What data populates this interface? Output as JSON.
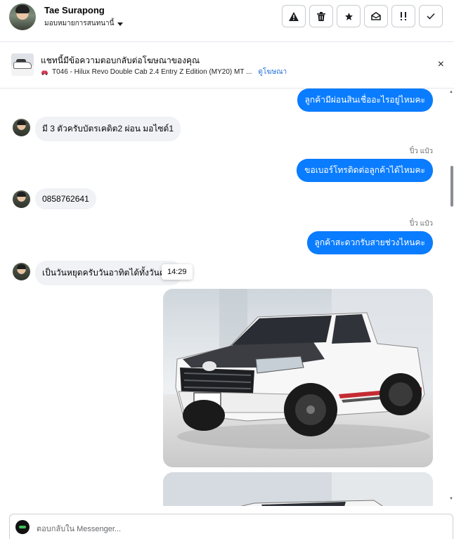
{
  "header": {
    "name": "Tae Surapong",
    "assign_label": "มอบหมายการสนทนานี้",
    "actions": [
      {
        "icon": "warning-icon",
        "glyph": "⚠"
      },
      {
        "icon": "trash-icon",
        "glyph": "🗑"
      },
      {
        "icon": "star-icon",
        "glyph": "★"
      },
      {
        "icon": "mark-unread-icon",
        "glyph": "✉"
      },
      {
        "icon": "follow-up-icon",
        "glyph": "!!"
      },
      {
        "icon": "check-icon",
        "glyph": "✓"
      }
    ]
  },
  "ad": {
    "title": "แชทนี้มีข้อความตอบกลับต่อโฆษณาของคุณ",
    "subtitle": "T046 - Hilux Revo Double Cab 2.4 Entry Z Edition (MY20) MT ...",
    "link": "ดูโฆษณา",
    "close": "×"
  },
  "messages": {
    "out1": "ลูกค้ามีผ่อนสินเชื่ออะไรอยู่ไหมคะ",
    "in1": "มี 3 ตัวครับบัตรเคดิต2 ผ่อน มอไซด์1",
    "sender2": "ปิ๋ว แป๋ว",
    "out2": "ขอเบอร์โทรติดต่อลูกค้าได้ไหมคะ",
    "in2": "0858762641",
    "sender3": "ปิ๋ว แป๋ว",
    "out3": "ลูกค้าสะดวกรับสายช่วงไหนคะ",
    "in3": "เป็นวันหยุดครับวันอาทิตได้ทั้งวันครับ",
    "tooltip_time": "14:29"
  },
  "composer": {
    "placeholder": "ตอบกลับใน Messenger..."
  },
  "colors": {
    "outgoing_bubble": "#0a7cff",
    "incoming_bubble": "#f0f2f5",
    "link": "#216fdb"
  }
}
